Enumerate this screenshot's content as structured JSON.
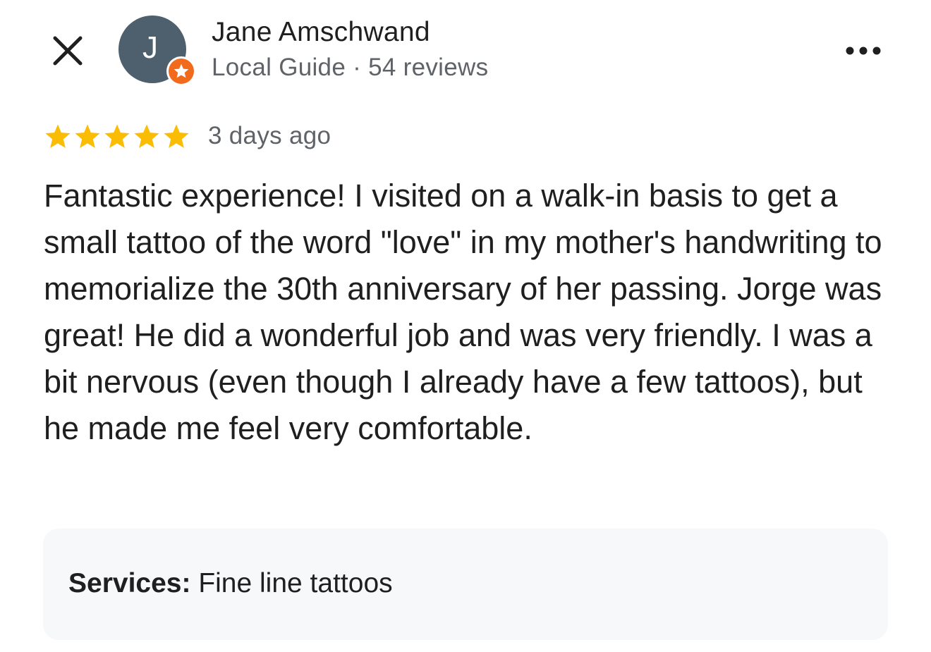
{
  "header": {
    "close_icon": "close-icon",
    "more_icon": "more-horizontal-icon",
    "author": {
      "initial": "J",
      "name": "Jane Amschwand",
      "meta": "Local Guide · 54 reviews",
      "badge_icon": "local-guide-star-icon",
      "avatar_color": "#4e606e",
      "badge_color": "#f26b1d"
    }
  },
  "review": {
    "rating": 5,
    "rating_max": 5,
    "star_color": "#fbbc04",
    "date": "3 days ago",
    "text": "Fantastic experience! I visited on a walk-in basis to get a small tattoo of the word \"love\" in my mother's handwriting to memorialize the 30th anniversary of her passing. Jorge was great! He did a wonderful job and was very friendly. I was a bit nervous (even though I already have a few tattoos), but he made me feel very comfortable."
  },
  "services": {
    "label": "Services:",
    "value": "Fine line tattoos"
  }
}
